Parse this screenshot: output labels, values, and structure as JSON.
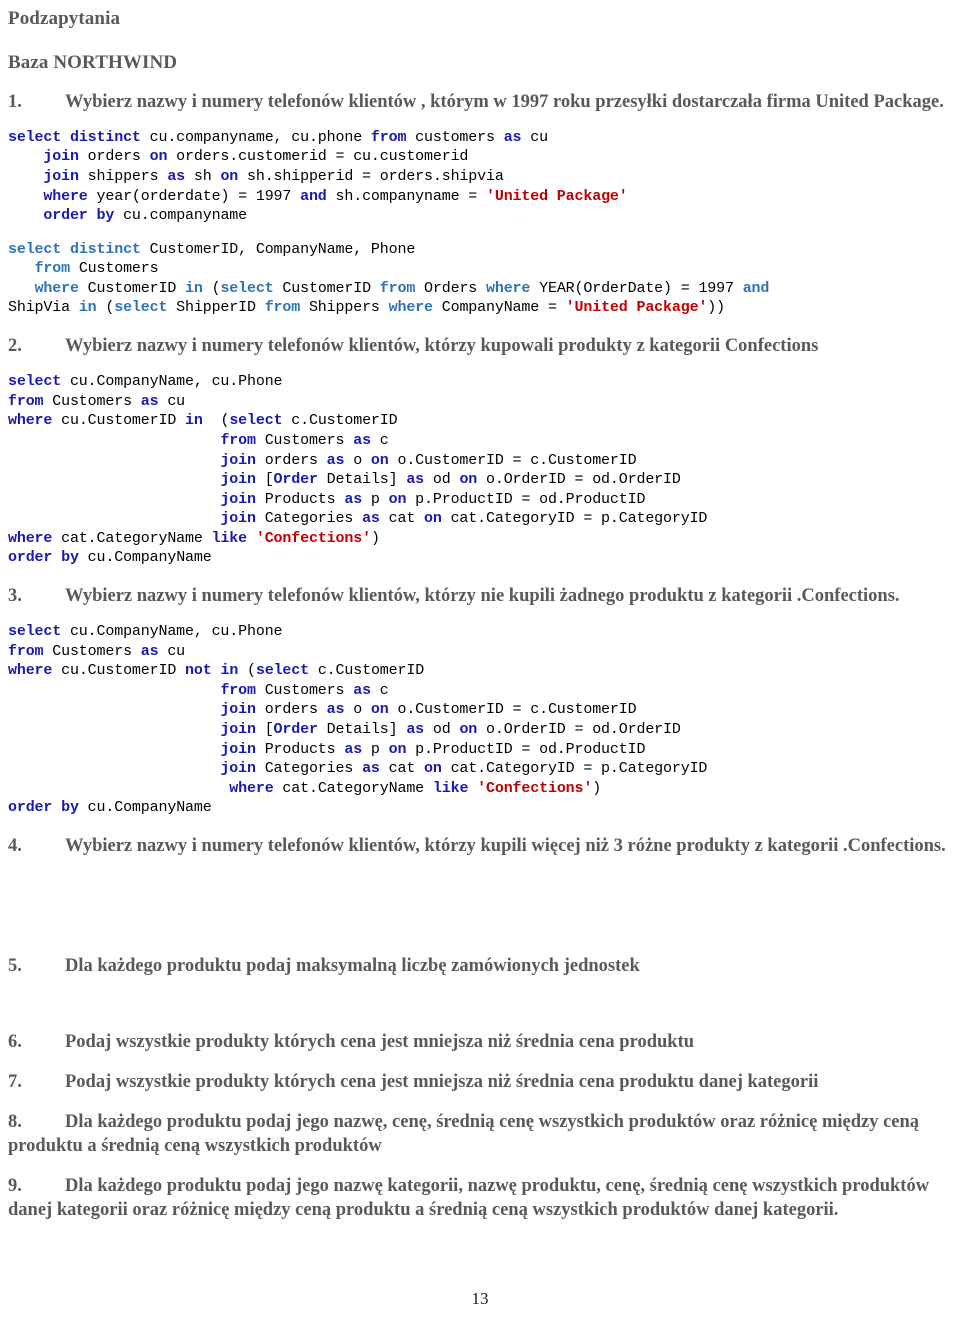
{
  "document": {
    "heading": "Podzapytania",
    "subheading": "Baza NORTHWIND",
    "page_number": "13"
  },
  "tasks": [
    {
      "number": "1.",
      "text": "Wybierz nazwy i numery telefonów klientów , którym w 1997 roku przesyłki dostarczała firma United Package."
    },
    {
      "number": "2.",
      "text": "Wybierz nazwy i numery telefonów klientów, którzy kupowali produkty z kategorii Confections"
    },
    {
      "number": "3.",
      "text": "Wybierz nazwy i numery telefonów klientów, którzy nie kupili żadnego produktu z kategorii .Confections."
    },
    {
      "number": "4.",
      "text": "Wybierz nazwy i numery telefonów klientów, którzy kupili więcej niż 3 różne produkty z kategorii .Confections."
    },
    {
      "number": "5.",
      "text": "Dla każdego produktu podaj maksymalną liczbę zamówionych jednostek"
    },
    {
      "number": "6.",
      "text": "Podaj wszystkie produkty których cena jest mniejsza niż średnia cena produktu"
    },
    {
      "number": "7.",
      "text": "Podaj wszystkie produkty których cena jest mniejsza niż średnia cena produktu danej kategorii"
    },
    {
      "number": "8.",
      "text": "Dla każdego produktu podaj jego nazwę, cenę, średnią cenę wszystkich produktów oraz różnicę między ceną produktu a średnią ceną wszystkich produktów"
    },
    {
      "number": "9.",
      "text": "Dla każdego produktu podaj jego nazwę kategorii, nazwę produktu, cenę, średnią cenę wszystkich produktów danej kategorii oraz różnicę między ceną produktu a średnią ceną wszystkich produktów danej kategorii."
    }
  ],
  "code_blocks": {
    "q1_a": "select distinct cu.companyname, cu.phone from customers as cu\n    join orders on orders.customerid = cu.customerid\n    join shippers as sh on sh.shipperid = orders.shipvia\n    where year(orderdate) = 1997 and sh.companyname = 'United Package'\n    order by cu.companyname",
    "q1_b": "select distinct CustomerID, CompanyName, Phone\n   from Customers\n   where CustomerID in (select CustomerID from Orders where YEAR(OrderDate) = 1997 and\nShipVia in (select ShipperID from Shippers where CompanyName = 'United Package'))",
    "q2": "select cu.CompanyName, cu.Phone\nfrom Customers as cu\nwhere cu.CustomerID in  (select c.CustomerID\n                        from Customers as c\n                        join orders as o on o.CustomerID = c.CustomerID\n                        join [Order Details] as od on o.OrderID = od.OrderID\n                        join Products as p on p.ProductID = od.ProductID\n                        join Categories as cat on cat.CategoryID = p.CategoryID\nwhere cat.CategoryName like 'Confections')\norder by cu.CompanyName",
    "q3": "select cu.CompanyName, cu.Phone\nfrom Customers as cu\nwhere cu.CustomerID not in (select c.CustomerID\n                        from Customers as c\n                        join orders as o on o.CustomerID = c.CustomerID\n                        join [Order Details] as od on o.OrderID = od.OrderID\n                        join Products as p on p.ProductID = od.ProductID\n                        join Categories as cat on cat.CategoryID = p.CategoryID\n                         where cat.CategoryName like 'Confections')\norder by cu.CompanyName"
  },
  "colors": {
    "heading_gray": "#595959",
    "keyword_blue": "#1a1aae",
    "keyword_light_blue": "#2e74b5",
    "string_red": "#c00000",
    "body_black": "#000000"
  }
}
